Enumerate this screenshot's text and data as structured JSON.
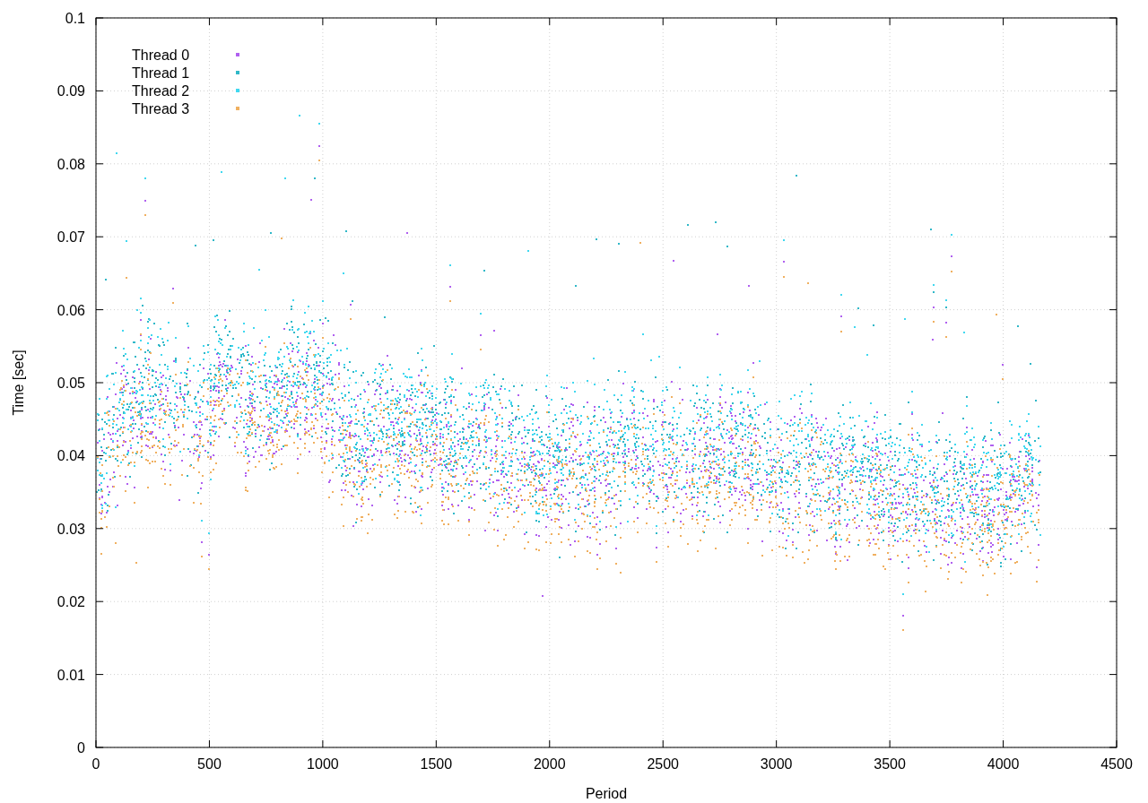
{
  "plot": {
    "y_axis_title": "Time [sec]",
    "x_axis_title": "Period",
    "y_tick_labels": [
      "0.1",
      "0.09",
      "0.08",
      "0.07",
      "0.06",
      "0.05",
      "0.04",
      "0.03",
      "0.02",
      "0.01",
      "0"
    ],
    "x_tick_labels": [
      "0",
      "500",
      "1000",
      "1500",
      "2000",
      "2500",
      "3000",
      "3500",
      "4000",
      "4500"
    ],
    "legend": [
      {
        "label": "Thread 0",
        "color": "#b060f0"
      },
      {
        "label": "Thread 1",
        "color": "#30b8c8"
      },
      {
        "label": "Thread 2",
        "color": "#40d8f0"
      },
      {
        "label": "Thread 3",
        "color": "#f0b060"
      }
    ]
  }
}
